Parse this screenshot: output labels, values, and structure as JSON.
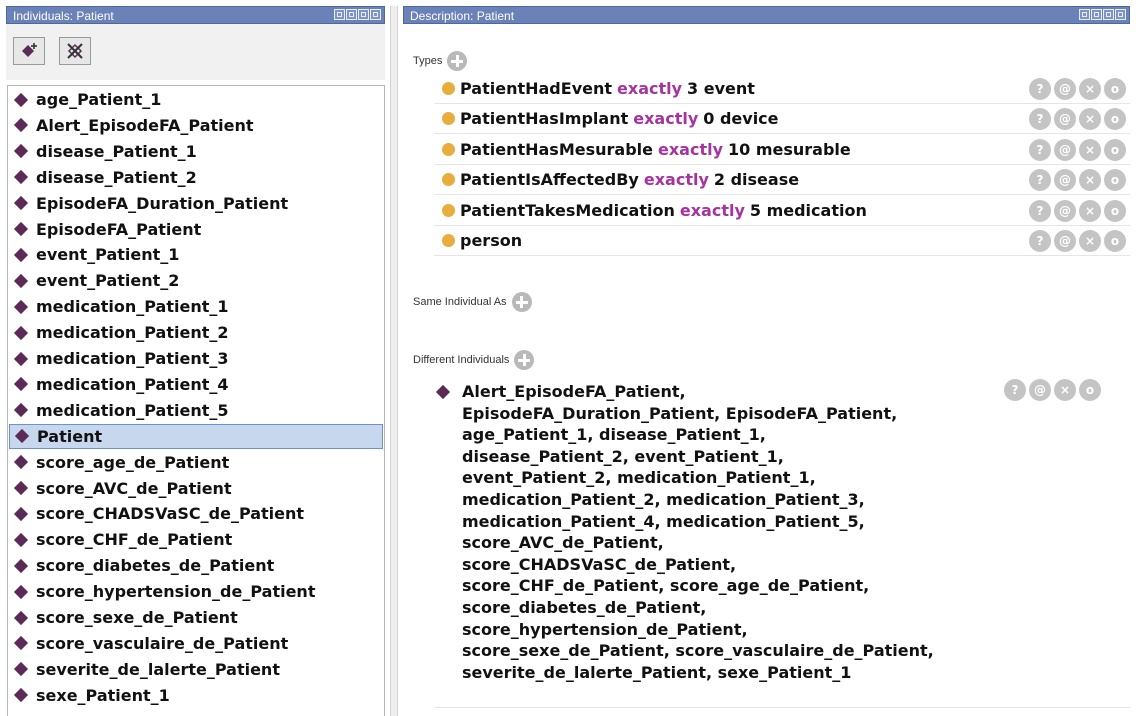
{
  "left_panel": {
    "title": "Individuals: Patient",
    "toolbar": {
      "add_icon": "add-individual-icon",
      "delete_icon": "delete-individual-icon"
    },
    "items": [
      "age_Patient_1",
      "Alert_EpisodeFA_Patient",
      "disease_Patient_1",
      "disease_Patient_2",
      "EpisodeFA_Duration_Patient",
      "EpisodeFA_Patient",
      "event_Patient_1",
      "event_Patient_2",
      "medication_Patient_1",
      "medication_Patient_2",
      "medication_Patient_3",
      "medication_Patient_4",
      "medication_Patient_5",
      "Patient",
      "score_age_de_Patient",
      "score_AVC_de_Patient",
      "score_CHADSVaSC_de_Patient",
      "score_CHF_de_Patient",
      "score_diabetes_de_Patient",
      "score_hypertension_de_Patient",
      "score_sexe_de_Patient",
      "score_vasculaire_de_Patient",
      "severite_de_lalerte_Patient",
      "sexe_Patient_1"
    ],
    "selected": "Patient"
  },
  "right_panel": {
    "title": "Description: Patient",
    "types_label": "Types",
    "types": [
      {
        "prop": "PatientHadEvent",
        "kw": "exactly",
        "rest": "3 event"
      },
      {
        "prop": "PatientHasImplant",
        "kw": "exactly",
        "rest": "0 device"
      },
      {
        "prop": "PatientHasMesurable",
        "kw": "exactly",
        "rest": "10 mesurable"
      },
      {
        "prop": "PatientIsAffectedBy",
        "kw": "exactly",
        "rest": "2 disease"
      },
      {
        "prop": "PatientTakesMedication",
        "kw": "exactly",
        "rest": "5 medication"
      },
      {
        "prop": "person",
        "kw": "",
        "rest": ""
      }
    ],
    "same_label": "Same Individual As",
    "different_label": "Different Individuals",
    "different_text": "Alert_EpisodeFA_Patient,\nEpisodeFA_Duration_Patient, EpisodeFA_Patient,\nage_Patient_1, disease_Patient_1,\ndisease_Patient_2, event_Patient_1,\nevent_Patient_2, medication_Patient_1,\nmedication_Patient_2, medication_Patient_3,\nmedication_Patient_4, medication_Patient_5,\nscore_AVC_de_Patient,\nscore_CHADSVaSC_de_Patient,\nscore_CHF_de_Patient, score_age_de_Patient,\nscore_diabetes_de_Patient,\nscore_hypertension_de_Patient,\nscore_sexe_de_Patient, score_vasculaire_de_Patient,\nseverite_de_lalerte_Patient, sexe_Patient_1",
    "actions": [
      "?",
      "@",
      "×",
      "o"
    ]
  },
  "colors": {
    "header": "#6a82b8",
    "individual": "#5b2a57",
    "class_dot": "#e8ad3c",
    "keyword": "#a6339f",
    "selection": "#c6d7ee"
  }
}
